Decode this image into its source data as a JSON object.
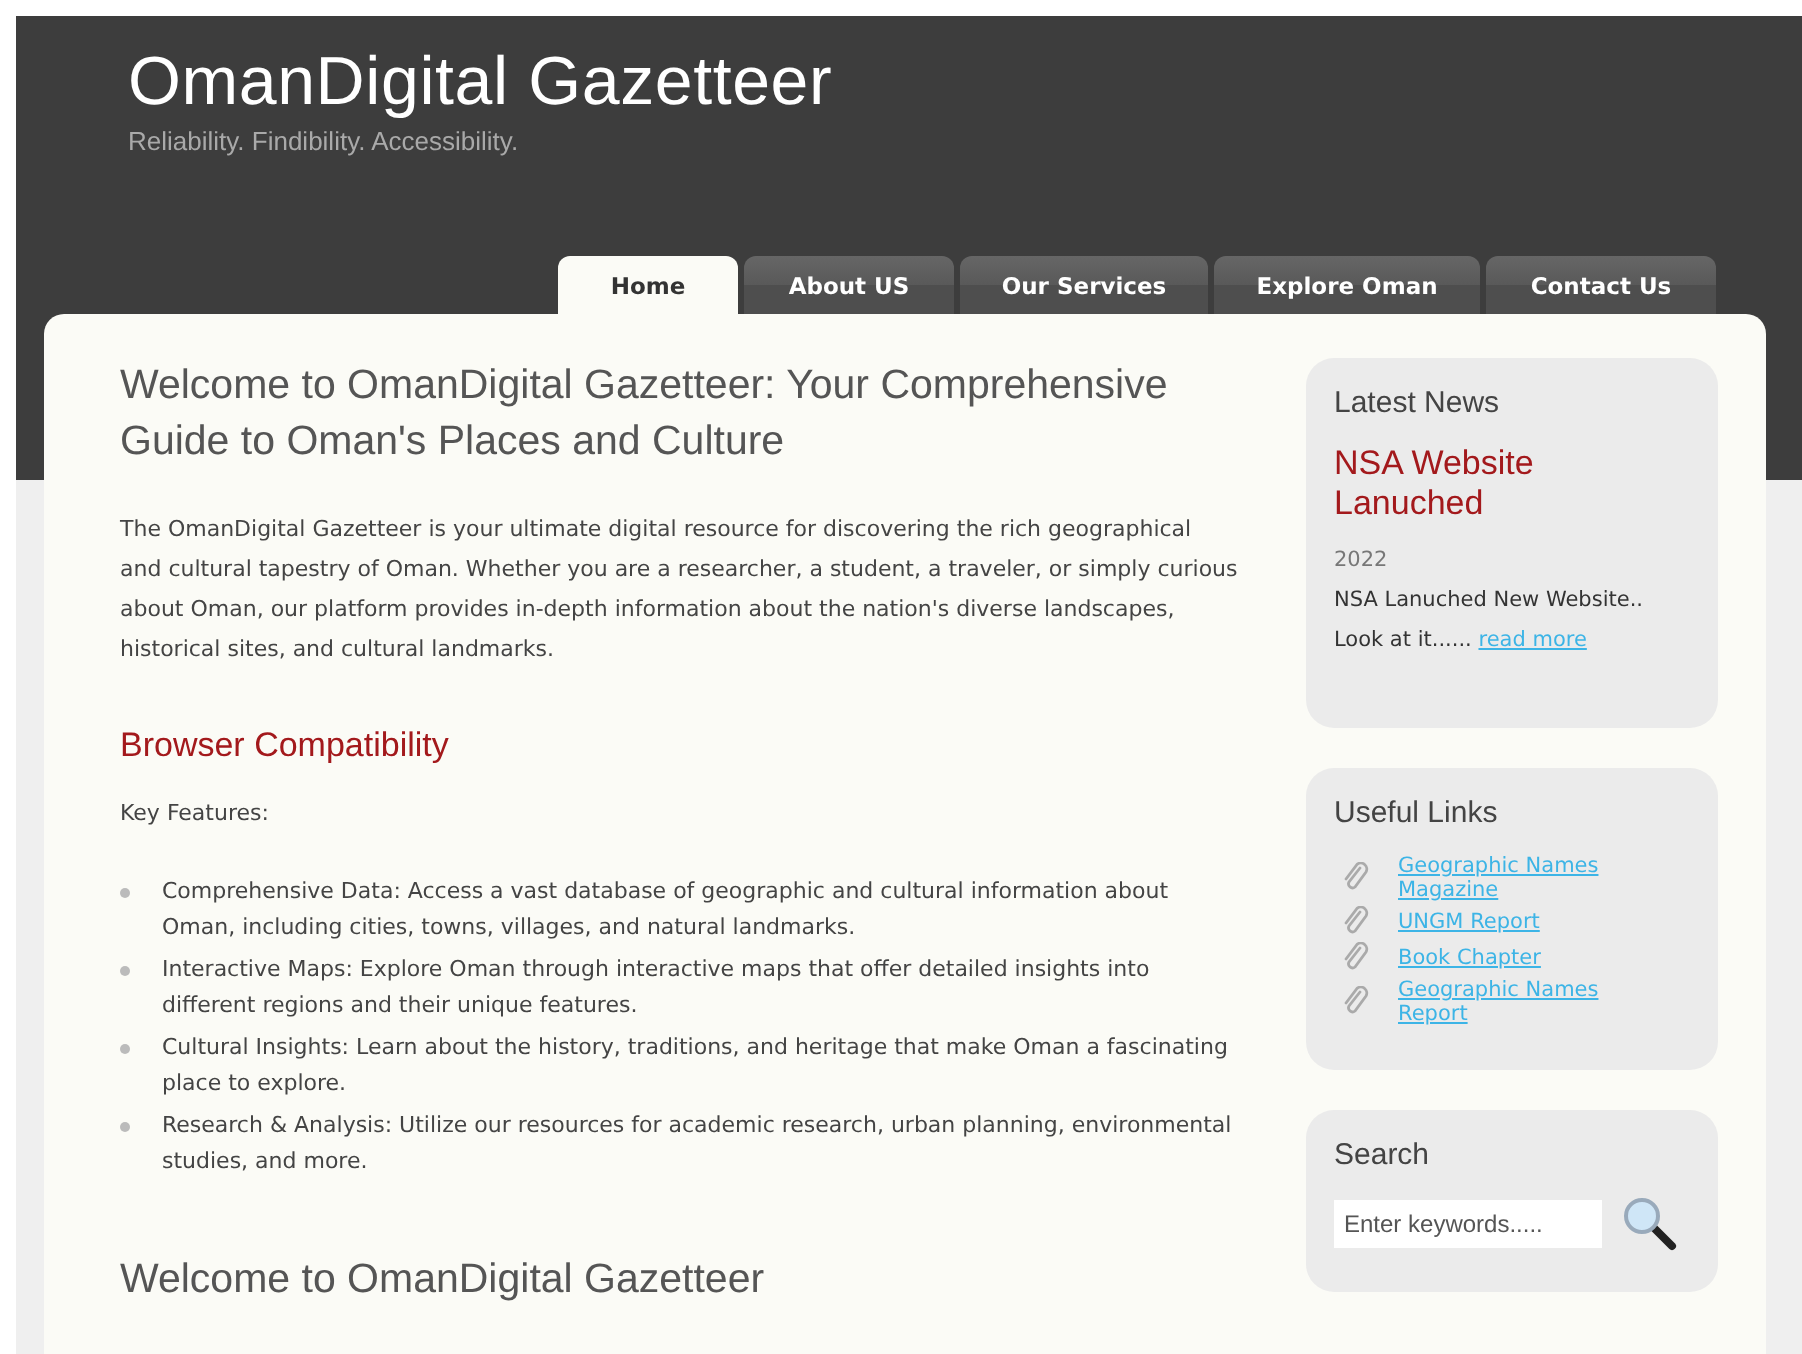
{
  "site": {
    "title": "OmanDigital Gazetteer",
    "tagline": "Reliability. Findibility. Accessibility."
  },
  "tabs": [
    {
      "label": "Home",
      "selected": true
    },
    {
      "label": "About US",
      "selected": false
    },
    {
      "label": "Our Services",
      "selected": false
    },
    {
      "label": "Explore Oman",
      "selected": false
    },
    {
      "label": "Contact Us",
      "selected": false
    }
  ],
  "main": {
    "heading": "Welcome to OmanDigital Gazetteer: Your Comprehensive Guide to Oman's Places and Culture",
    "intro": "The OmanDigital Gazetteer is your ultimate digital resource for discovering the rich geographical and cultural tapestry of Oman. Whether you are a researcher, a student, a traveler, or simply curious about Oman, our platform provides in-depth information about the nation's diverse landscapes, historical sites, and cultural landmarks.",
    "section_heading": "Browser Compatibility",
    "features_label": "Key Features:",
    "features": [
      "Comprehensive Data: Access a vast database of geographic and cultural information about Oman, including cities, towns, villages, and natural landmarks.",
      "Interactive Maps: Explore Oman through interactive maps that offer detailed insights into different regions and their unique features.",
      "Cultural Insights: Learn about the history, traditions, and heritage that make Oman a fascinating place to explore.",
      "Research & Analysis: Utilize our resources for academic research, urban planning, environmental studies, and more."
    ],
    "footer_heading": "Welcome to OmanDigital Gazetteer"
  },
  "sidebar": {
    "news": {
      "title": "Latest News",
      "headline": "NSA Website Lanuched",
      "year": "2022",
      "text": "NSA Lanuched New Website.. Look at it......",
      "link": "read more"
    },
    "links": {
      "title": "Useful Links",
      "items": [
        "Geographic Names Magazine",
        "UNGM Report",
        "Book Chapter",
        "Geographic Names Report"
      ]
    },
    "search": {
      "title": "Search",
      "placeholder": "Enter keywords....."
    }
  }
}
